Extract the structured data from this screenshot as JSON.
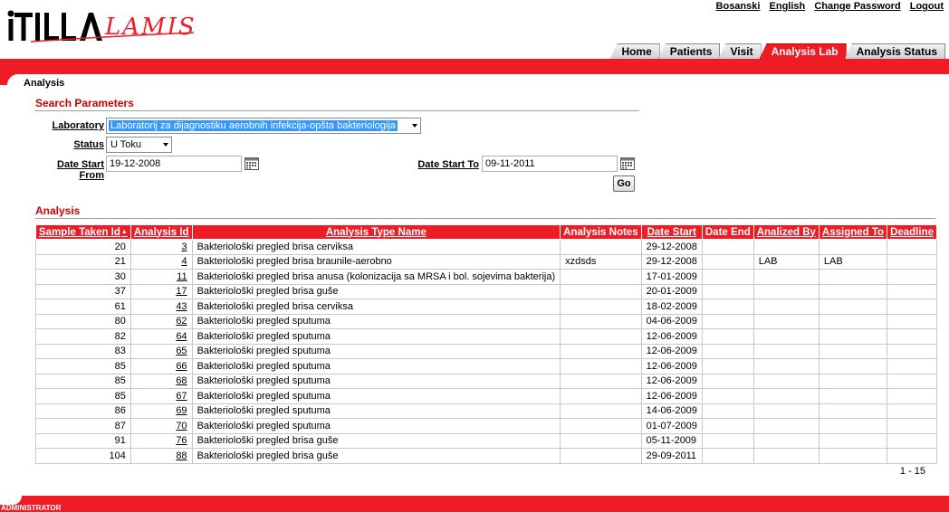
{
  "header": {
    "logo_text_left": "ITILLA",
    "logo_text_right": "LAMIS",
    "links": [
      "Bosanski",
      "English",
      "Change Password",
      "Logout"
    ]
  },
  "tabs": [
    {
      "label": "Home",
      "active": false
    },
    {
      "label": "Patients",
      "active": false
    },
    {
      "label": "Visit",
      "active": false
    },
    {
      "label": "Analysis Lab",
      "active": true
    },
    {
      "label": "Analysis Status",
      "active": false
    }
  ],
  "breadcrumb": "Analysis",
  "search": {
    "title": "Search Parameters",
    "laboratory_label": "Laboratory",
    "laboratory_value": "Laboratorij za dijagnostiku aerobnih infekcija-opšta bakteriologija",
    "status_label": "Status",
    "status_value": "U Toku",
    "date_from_label": "Date Start From",
    "date_from_value": "19-12-2008",
    "date_to_label": "Date Start To",
    "date_to_value": "09-11-2011",
    "go_label": "Go"
  },
  "analysis": {
    "title": "Analysis",
    "columns": [
      "Sample Taken Id",
      "Analysis Id",
      "Analysis Type Name",
      "Analysis Notes",
      "Date Start",
      "Date End",
      "Analized By",
      "Assigned To",
      "Deadline"
    ],
    "rows": [
      [
        "20",
        "3",
        "Bakteriološki pregled brisa cerviksa",
        "",
        "29-12-2008",
        "",
        "",
        "",
        ""
      ],
      [
        "21",
        "4",
        "Bakteriološki pregled brisa braunile-aerobno",
        "xzdsds",
        "29-12-2008",
        "",
        "LAB",
        "LAB",
        ""
      ],
      [
        "30",
        "11",
        "Bakteriološki pregled brisa anusa (kolonizacija sa MRSA i bol. sojevima bakterija)",
        "",
        "17-01-2009",
        "",
        "",
        "",
        ""
      ],
      [
        "37",
        "17",
        "Bakteriološki pregled brisa guše",
        "",
        "20-01-2009",
        "",
        "",
        "",
        ""
      ],
      [
        "61",
        "43",
        "Bakteriološki pregled brisa cerviksa",
        "",
        "18-02-2009",
        "",
        "",
        "",
        ""
      ],
      [
        "80",
        "62",
        "Bakteriološki pregled sputuma",
        "",
        "04-06-2009",
        "",
        "",
        "",
        ""
      ],
      [
        "82",
        "64",
        "Bakteriološki pregled sputuma",
        "",
        "12-06-2009",
        "",
        "",
        "",
        ""
      ],
      [
        "83",
        "65",
        "Bakteriološki pregled sputuma",
        "",
        "12-06-2009",
        "",
        "",
        "",
        ""
      ],
      [
        "85",
        "66",
        "Bakteriološki pregled sputuma",
        "",
        "12-06-2009",
        "",
        "",
        "",
        ""
      ],
      [
        "85",
        "68",
        "Bakteriološki pregled sputuma",
        "",
        "12-06-2009",
        "",
        "",
        "",
        ""
      ],
      [
        "85",
        "67",
        "Bakteriološki pregled sputuma",
        "",
        "12-06-2009",
        "",
        "",
        "",
        ""
      ],
      [
        "86",
        "69",
        "Bakteriološki pregled sputuma",
        "",
        "14-06-2009",
        "",
        "",
        "",
        ""
      ],
      [
        "87",
        "70",
        "Bakteriološki pregled sputuma",
        "",
        "01-07-2009",
        "",
        "",
        "",
        ""
      ],
      [
        "91",
        "76",
        "Bakteriološki pregled brisa guše",
        "",
        "05-11-2009",
        "",
        "",
        "",
        ""
      ],
      [
        "104",
        "88",
        "Bakteriološki pregled brisa guše",
        "",
        "29-09-2011",
        "",
        "",
        "",
        ""
      ]
    ],
    "pager": "1 - 15"
  },
  "footer": {
    "user": "ADMINISTRATOR"
  },
  "colors": {
    "brand_red": "#ee1c24"
  },
  "icons": {
    "calendar": "calendar-icon",
    "sort": "sort-asc-icon",
    "dropdown": "chevron-down-icon"
  }
}
